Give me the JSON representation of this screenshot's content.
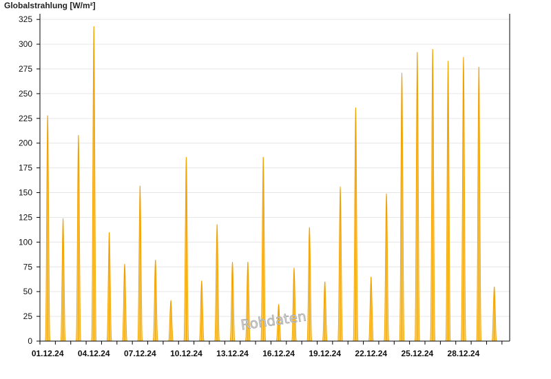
{
  "chart_data": {
    "type": "area",
    "title": "Globalstrahlung [W/m²]",
    "ylim": [
      0,
      330
    ],
    "y_ticks": [
      0,
      25,
      50,
      75,
      100,
      125,
      150,
      175,
      200,
      225,
      250,
      275,
      300,
      325
    ],
    "x_range": [
      "2024-12-01",
      "2024-12-31"
    ],
    "x_tick_labels": [
      "01.12.24",
      "04.12.24",
      "07.12.24",
      "10.12.24",
      "13.12.24",
      "16.12.24",
      "19.12.24",
      "22.12.24",
      "25.12.24",
      "28.12.24"
    ],
    "grid": true,
    "series": [
      {
        "x": [
          "2024-12-01",
          "2024-12-02",
          "2024-12-03",
          "2024-12-04",
          "2024-12-05",
          "2024-12-06",
          "2024-12-07",
          "2024-12-08",
          "2024-12-09",
          "2024-12-10",
          "2024-12-11",
          "2024-12-12",
          "2024-12-13",
          "2024-12-14",
          "2024-12-15",
          "2024-12-16",
          "2024-12-17",
          "2024-12-18",
          "2024-12-19",
          "2024-12-20",
          "2024-12-21",
          "2024-12-22",
          "2024-12-23",
          "2024-12-24",
          "2024-12-25",
          "2024-12-26",
          "2024-12-27",
          "2024-12-28",
          "2024-12-29",
          "2024-12-30"
        ],
        "values": [
          228,
          124,
          208,
          318,
          110,
          78,
          157,
          82,
          41,
          186,
          61,
          118,
          80,
          80,
          186,
          37,
          74,
          115,
          60,
          156,
          236,
          65,
          149,
          271,
          292,
          295,
          283,
          287,
          277,
          55
        ],
        "color": "#ffc94a",
        "stroke": "#f0a000"
      }
    ],
    "watermark": "Rohdaten"
  }
}
